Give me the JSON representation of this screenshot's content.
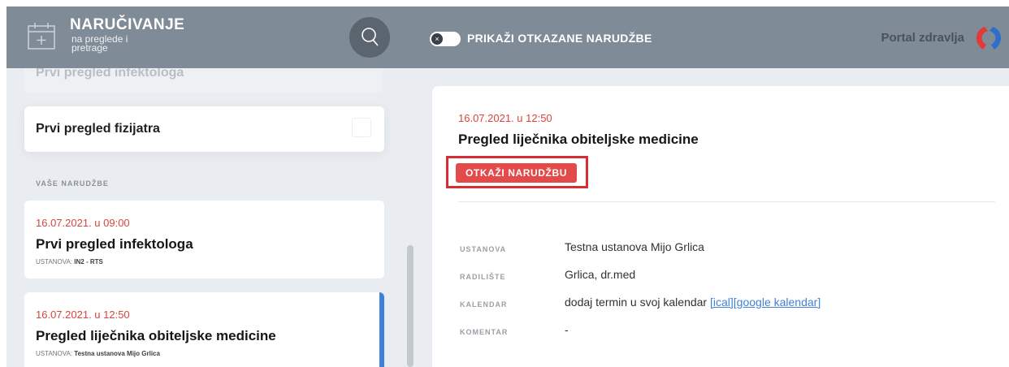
{
  "header": {
    "title": "NARUČIVANJE",
    "subtitle_line1": "na preglede i",
    "subtitle_line2": "pretrage",
    "toggle_label": "PRIKAŽI OTKAZANE NARUDŽBE",
    "portal_label": "Portal zdravlja",
    "toggle_knob": "×"
  },
  "sidebar": {
    "previous_card_title": "Prvi pregled infektologa",
    "fizijatar_card_title": "Prvi pregled fizijatra",
    "section_label": "VAŠE NARUDŽBE",
    "appointments": [
      {
        "date": "16.07.2021. u 09:00",
        "name": "Prvi pregled infektologa",
        "meta_label": "USTANOVA:",
        "meta_value": "IN2 - RTS"
      },
      {
        "date": "16.07.2021. u 12:50",
        "name": "Pregled liječnika obiteljske medicine",
        "meta_label": "USTANOVA:",
        "meta_value": "Testna ustanova Mijo Grlica"
      }
    ]
  },
  "detail": {
    "date": "16.07.2021. u 12:50",
    "title": "Pregled liječnika obiteljske medicine",
    "cancel_label": "OTKAŽI NARUDŽBU",
    "rows": [
      {
        "label": "USTANOVA",
        "value": "Testna ustanova Mijo Grlica"
      },
      {
        "label": "RADILIŠTE",
        "value": "Grlica, dr.med"
      },
      {
        "label": "KALENDAR",
        "value": "dodaj termin u svoj kalendar",
        "link_ical": "[ical]",
        "link_google": "[google kalendar]"
      },
      {
        "label": "KOMENTAR",
        "value": "-"
      }
    ]
  },
  "colors": {
    "header_bg": "#7f8b97",
    "accent_red": "#e34a4a",
    "highlight_border": "#d62e32",
    "active_blue": "#3f82d9"
  },
  "icons": [
    "calendar-add-icon",
    "search-icon",
    "toggle-x-icon",
    "portal-logo-icon"
  ]
}
